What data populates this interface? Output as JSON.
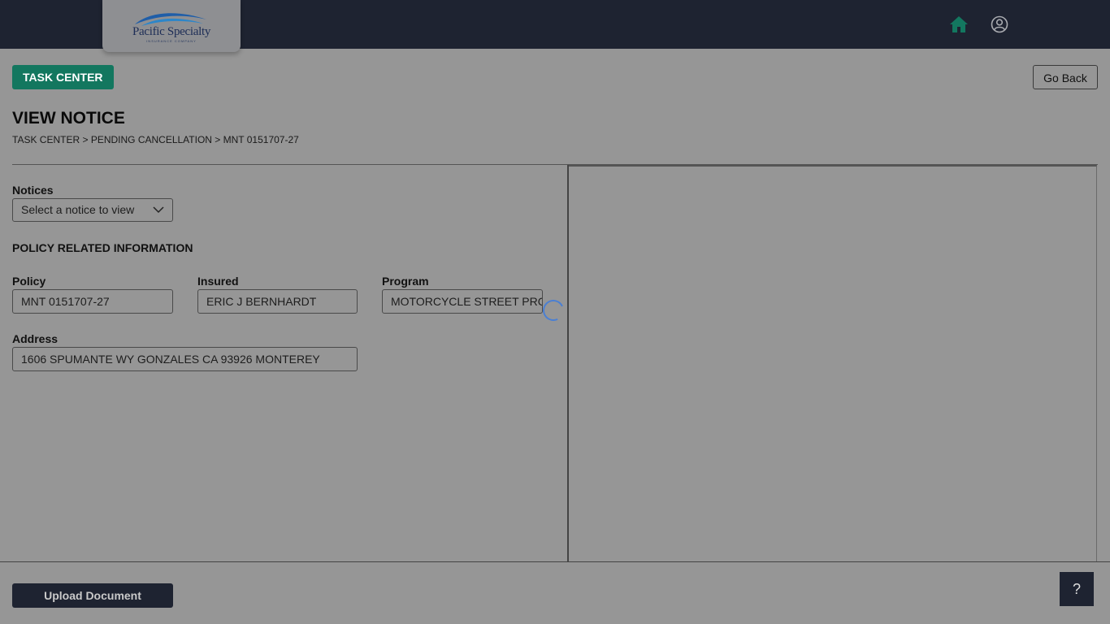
{
  "header": {
    "logo_text": "Pacific Specialty",
    "logo_subtext": "INSURANCE COMPANY",
    "home_icon": "home-icon",
    "user_icon": "user-circle-icon",
    "home_icon_color": "#13775f"
  },
  "toolbar": {
    "task_center_label": "TASK CENTER",
    "go_back_label": "Go Back"
  },
  "page": {
    "title": "VIEW NOTICE",
    "breadcrumb": [
      "TASK CENTER",
      "PENDING CANCELLATION",
      "MNT 0151707-27"
    ],
    "breadcrumb_separator": " > "
  },
  "notices": {
    "label": "Notices",
    "selected": "Select a notice to view"
  },
  "policy_info": {
    "section_title": "POLICY RELATED INFORMATION",
    "policy_label": "Policy",
    "policy_value": "MNT 0151707-27",
    "insured_label": "Insured",
    "insured_value": "ERIC J BERNHARDT",
    "program_label": "Program",
    "program_value": "MOTORCYCLE STREET PROGRAM",
    "address_label": "Address",
    "address_value": "1606 SPUMANTE WY GONZALES CA 93926 MONTEREY"
  },
  "footer": {
    "upload_label": "Upload Document",
    "help_label": "?"
  },
  "colors": {
    "header_bg": "#1e2331",
    "accent": "#13775f",
    "overlay_bg": "#969696",
    "spinner": "#4a7fd3"
  }
}
